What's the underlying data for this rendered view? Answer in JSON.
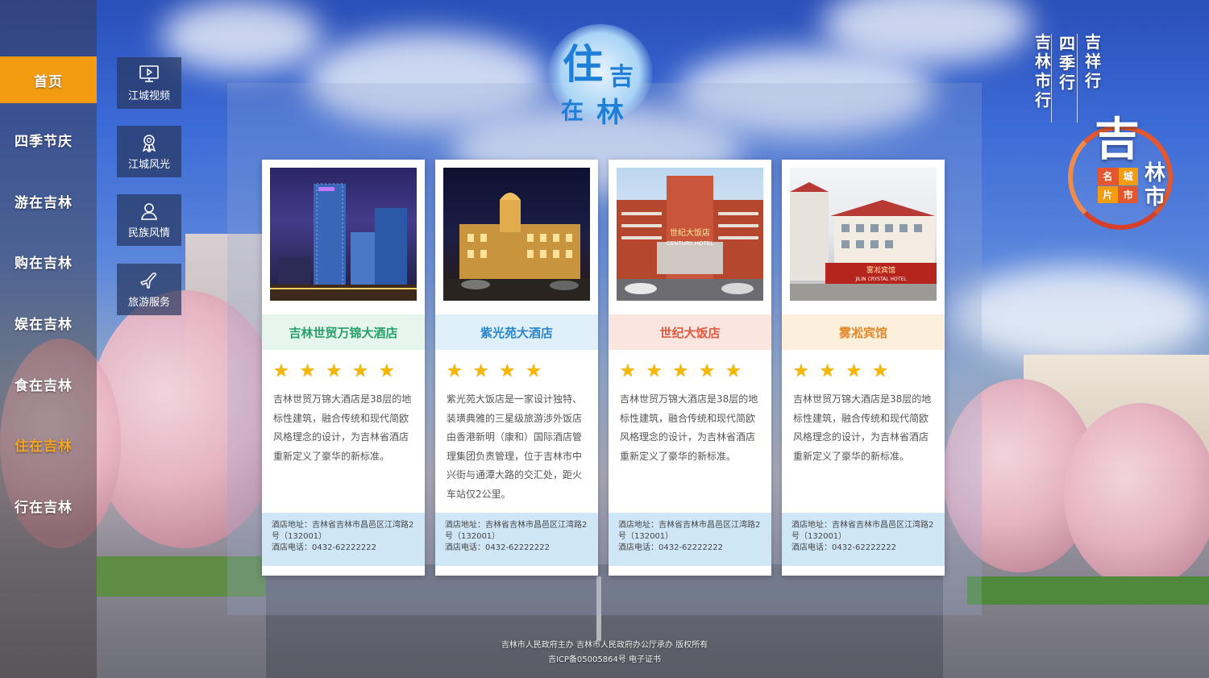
{
  "nav": {
    "home": "首页",
    "items": [
      {
        "label": "四季节庆"
      },
      {
        "label": "游在吉林"
      },
      {
        "label": "购在吉林"
      },
      {
        "label": "娱在吉林"
      },
      {
        "label": "食在吉林"
      },
      {
        "label": "住在吉林"
      },
      {
        "label": "行在吉林"
      }
    ],
    "active_index": 5
  },
  "quick_links": [
    {
      "label": "江城视频",
      "icon": "monitor-icon"
    },
    {
      "label": "江城风光",
      "icon": "ribbon-award-icon"
    },
    {
      "label": "民族风情",
      "icon": "person-icon"
    },
    {
      "label": "旅游服务",
      "icon": "airplane-icon"
    }
  ],
  "logo": {
    "char1": "住",
    "char2": "吉",
    "char3": "在",
    "char4": "林"
  },
  "slogan": {
    "col1": "吉祥行",
    "col2": "四季行",
    "col3": "吉林市行"
  },
  "seal": {
    "big": "吉",
    "small": "林市",
    "box": [
      "名",
      "城",
      "片",
      "市"
    ]
  },
  "hotels": [
    {
      "name": "吉林世贸万锦大酒店",
      "stars": 5,
      "description": "吉林世贸万锦大酒店是38层的地标性建筑，融合传统和现代简欧风格理念的设计，为吉林省酒店重新定义了豪华的新标准。",
      "address": "酒店地址：吉林省吉林市昌邑区江湾路2号（132001）",
      "phone": "酒店电话：0432-62222222"
    },
    {
      "name": "紫光苑大酒店",
      "stars": 4,
      "description": "紫光苑大饭店是一家设计独特、装璜典雅的三星级旅游涉外饭店由香港新明（康和）国际酒店管理集团负责管理，位于吉林市中兴街与通潭大路的交汇处，距火车站仅2公里。",
      "address": "酒店地址：吉林省吉林市昌邑区江湾路2号（132001）",
      "phone": "酒店电话：0432-62222222"
    },
    {
      "name": "世纪大饭店",
      "stars": 5,
      "description": "吉林世贸万锦大酒店是38层的地标性建筑，融合传统和现代简欧风格理念的设计，为吉林省酒店重新定义了豪华的新标准。",
      "address": "酒店地址：吉林省吉林市昌邑区江湾路2号（132001）",
      "phone": "酒店电话：0432-62222222"
    },
    {
      "name": "雾凇宾馆",
      "stars": 4,
      "description": "吉林世贸万锦大酒店是38层的地标性建筑，融合传统和现代简欧风格理念的设计，为吉林省酒店重新定义了豪华的新标准。",
      "address": "酒店地址：吉林省吉林市昌邑区江湾路2号（132001）",
      "phone": "酒店电话：0432-62222222"
    }
  ],
  "photo_signs": {
    "hotel3": "世纪大饭店",
    "hotel3_en": "CENTURY HOTEL",
    "hotel4": "雾凇宾馆",
    "hotel4_en": "JILIN CRYSTAL HOTEL"
  },
  "footer": {
    "line1": "吉林市人民政府主办  吉林市人民政府办公厅承办  版权所有",
    "line2": "吉ICP备05005864号  电子证书"
  },
  "colors": {
    "nav_home_bg": "#f39c12",
    "nav_active_text": "#f5a623",
    "hotel1_accent": "#27a06a",
    "hotel2_accent": "#2b86c9",
    "hotel3_accent": "#e05a3f",
    "hotel4_accent": "#e08a2a"
  }
}
